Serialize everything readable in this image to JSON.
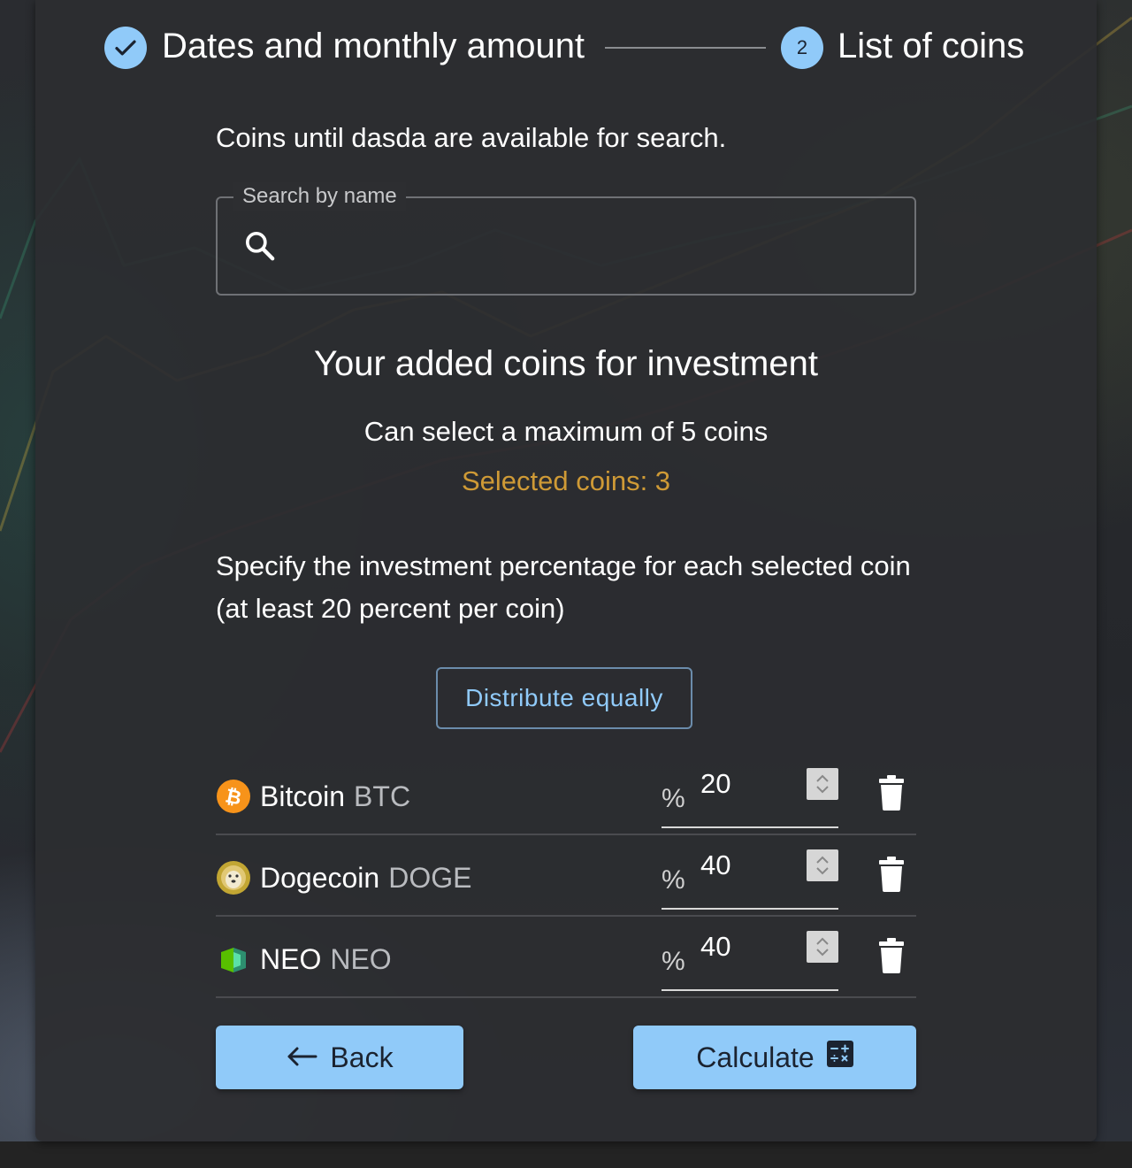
{
  "stepper": {
    "step1": {
      "label": "Dates and monthly amount",
      "status": "completed"
    },
    "step2": {
      "label": "List of coins",
      "number": "2",
      "status": "active"
    }
  },
  "search": {
    "info": "Coins until dasda are available for search.",
    "label": "Search by name",
    "value": "",
    "placeholder": ""
  },
  "investment": {
    "title": "Your added coins for investment",
    "max_text": "Can select a maximum of 5 coins",
    "selected_text": "Selected coins: 3",
    "specify_text": "Specify the investment percentage for each selected coin (at least 20 percent per coin)",
    "distribute_label": "Distribute equally"
  },
  "coins": [
    {
      "name": "Bitcoin",
      "symbol": "BTC",
      "percent_sign": "%",
      "percent": "20",
      "icon": "bitcoin-icon",
      "color": "#f7931a"
    },
    {
      "name": "Dogecoin",
      "symbol": "DOGE",
      "percent_sign": "%",
      "percent": "40",
      "icon": "dogecoin-icon",
      "color": "#c2a633"
    },
    {
      "name": "NEO",
      "symbol": "NEO",
      "percent_sign": "%",
      "percent": "40",
      "icon": "neo-icon",
      "color": "#58bf00"
    }
  ],
  "actions": {
    "back_label": "Back",
    "calculate_label": "Calculate"
  },
  "colors": {
    "accent": "#90caf9",
    "selected_text": "#cf9a36",
    "panel": "#2c2d30"
  }
}
